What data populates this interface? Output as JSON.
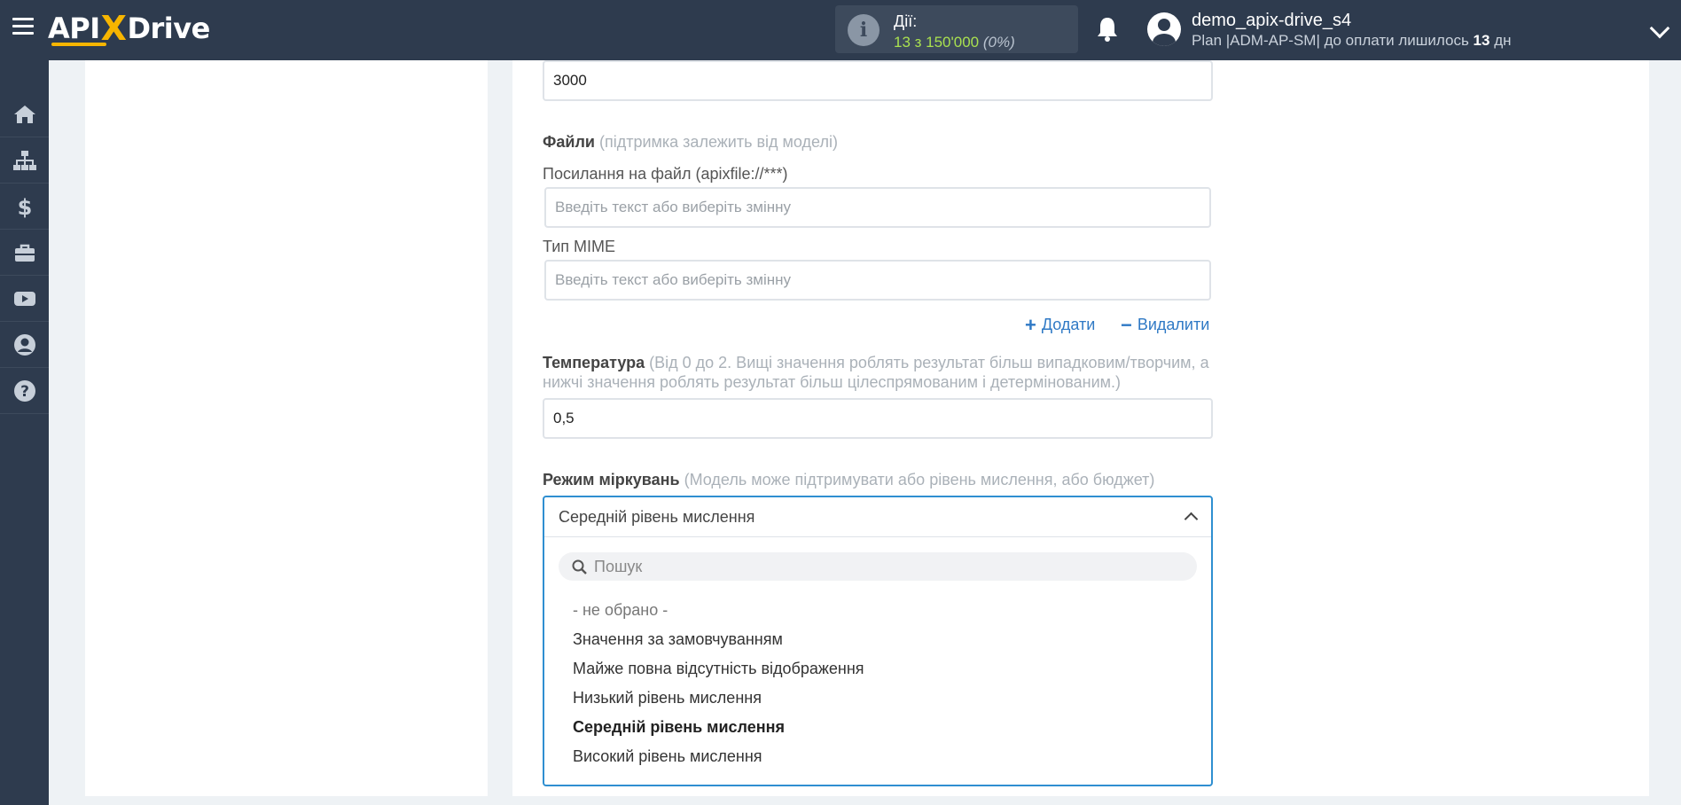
{
  "header": {
    "logo": {
      "part1": "API",
      "x": "X",
      "part2": "Drive"
    },
    "actions": {
      "label": "Дії:",
      "count": "13 з 150'000",
      "percent": "(0%)"
    },
    "user": {
      "name": "demo_apix-drive_s4",
      "plan_prefix": "Plan |ADM-AP-SM| до оплати лишилось ",
      "days": "13",
      "plan_suffix": " дн"
    }
  },
  "sidebar": {
    "items": [
      {
        "icon": "home-icon"
      },
      {
        "icon": "sitemap-icon"
      },
      {
        "icon": "dollar-icon"
      },
      {
        "icon": "briefcase-icon"
      },
      {
        "icon": "youtube-icon"
      },
      {
        "icon": "user-circle-icon"
      },
      {
        "icon": "help-icon"
      }
    ]
  },
  "form": {
    "max_tokens_value": "3000",
    "files": {
      "label": "Файли",
      "hint": "(підтримка залежить від моделі)",
      "link_label": "Посилання на файл (apixfile://***)",
      "link_placeholder": "Введіть текст або виберіть змінну",
      "mime_label": "Тип MIME",
      "mime_placeholder": "Введіть текст або виберіть змінну",
      "add_label": "Додати",
      "remove_label": "Видалити"
    },
    "temperature": {
      "label": "Температура",
      "hint1": "(Від 0 до 2. Вищі значення роблять результат більш випадковим/творчим, а",
      "hint2": "нижчі значення роблять результат більш цілеспрямованим і детермінованим.)",
      "value": "0,5"
    },
    "reasoning": {
      "label": "Режим міркувань",
      "hint": "(Модель може підтримувати або рівень мислення, або бюджет)",
      "selected": "Середній рівень мислення",
      "search_placeholder": "Пошук",
      "options": [
        "- не обрано -",
        "Значення за замовчуванням",
        "Майже повна відсутність відображення",
        "Низький рівень мислення",
        "Середній рівень мислення",
        "Високий рівень мислення"
      ]
    }
  },
  "colors": {
    "topbar": "#2e3b4e",
    "accent_yellow": "#f7b500",
    "link_blue": "#2f79c5",
    "focus_blue": "#2f8fd1",
    "count_green": "#a9e04f"
  }
}
